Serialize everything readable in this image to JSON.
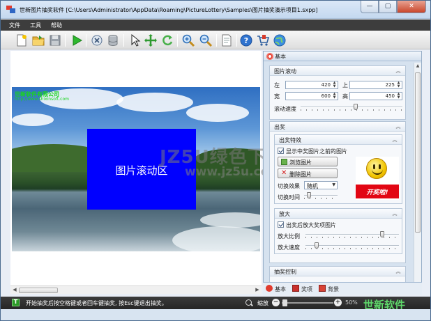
{
  "window": {
    "title": "世新图片抽奖软件 [C:\\Users\\Administrator\\AppData\\Roaming\\PictureLottery\\Samples\\图片抽奖演示项目1.sxpp]",
    "min_glyph": "—",
    "max_glyph": "▢",
    "close_glyph": "✕"
  },
  "menu": [
    "文件",
    "工具",
    "帮助"
  ],
  "toolbar": {
    "icons": [
      "new-file-icon",
      "open-folder-icon",
      "save-icon",
      "play-icon",
      "settings-wrench-icon",
      "database-icon",
      "pointer-icon",
      "move-icon",
      "refresh-icon",
      "zoom-in-icon",
      "zoom-out-icon",
      "document-icon",
      "help-icon",
      "cart-icon",
      "globe-icon"
    ]
  },
  "canvas": {
    "company_name": "世新软件有限公司",
    "company_url": "http://www.shixinsoft.com",
    "scroll_area_label": "图片滚动区",
    "scroll_area_color": "#0000ff"
  },
  "watermark": {
    "text": "JZ5U绿色下载",
    "url": "www.jz5u.com"
  },
  "panel": {
    "header": "基本",
    "image_scroll": {
      "title": "图片滚动",
      "left_label": "左",
      "left_value": "420",
      "top_label": "上",
      "top_value": "225",
      "width_label": "宽",
      "width_value": "600",
      "height_label": "高",
      "height_value": "450",
      "speed_label": "滚动速度",
      "speed_level": 0.55
    },
    "draw": {
      "title": "出奖",
      "effect_title": "出奖特效",
      "show_prev_label": "显示中奖图片之前的图片",
      "show_prev_checked": true,
      "browse_button": "浏览图片",
      "delete_button": "删除图片",
      "switch_effect_label": "切换效果",
      "switch_effect_value": "随机",
      "switch_time_label": "切换时间",
      "switch_time_level": 0.1,
      "banner_text": "开奖啦!",
      "banner_color": "#e20613"
    },
    "enlarge": {
      "title": "放大",
      "enlarge_after_label": "出奖后放大奖项图片",
      "enlarge_after_checked": true,
      "ratio_label": "放大比例",
      "ratio_level": 0.85,
      "speed_label": "放大速度",
      "speed_level": 0.1
    },
    "control": {
      "title": "抽奖控制"
    }
  },
  "tabs": [
    {
      "label": "基本",
      "icon": "gear-icon"
    },
    {
      "label": "奖项",
      "icon": "prize-icon"
    },
    {
      "label": "背景",
      "icon": "image-icon"
    }
  ],
  "status": {
    "icon_glyph": "T",
    "message": "开始抽奖后按空格键或者回车键抽奖, 按Esc键退出抽奖。",
    "zoom_label": "缩放",
    "zoom_level": 0.02,
    "zoom_percent": "50%",
    "brand": "世新软件"
  }
}
